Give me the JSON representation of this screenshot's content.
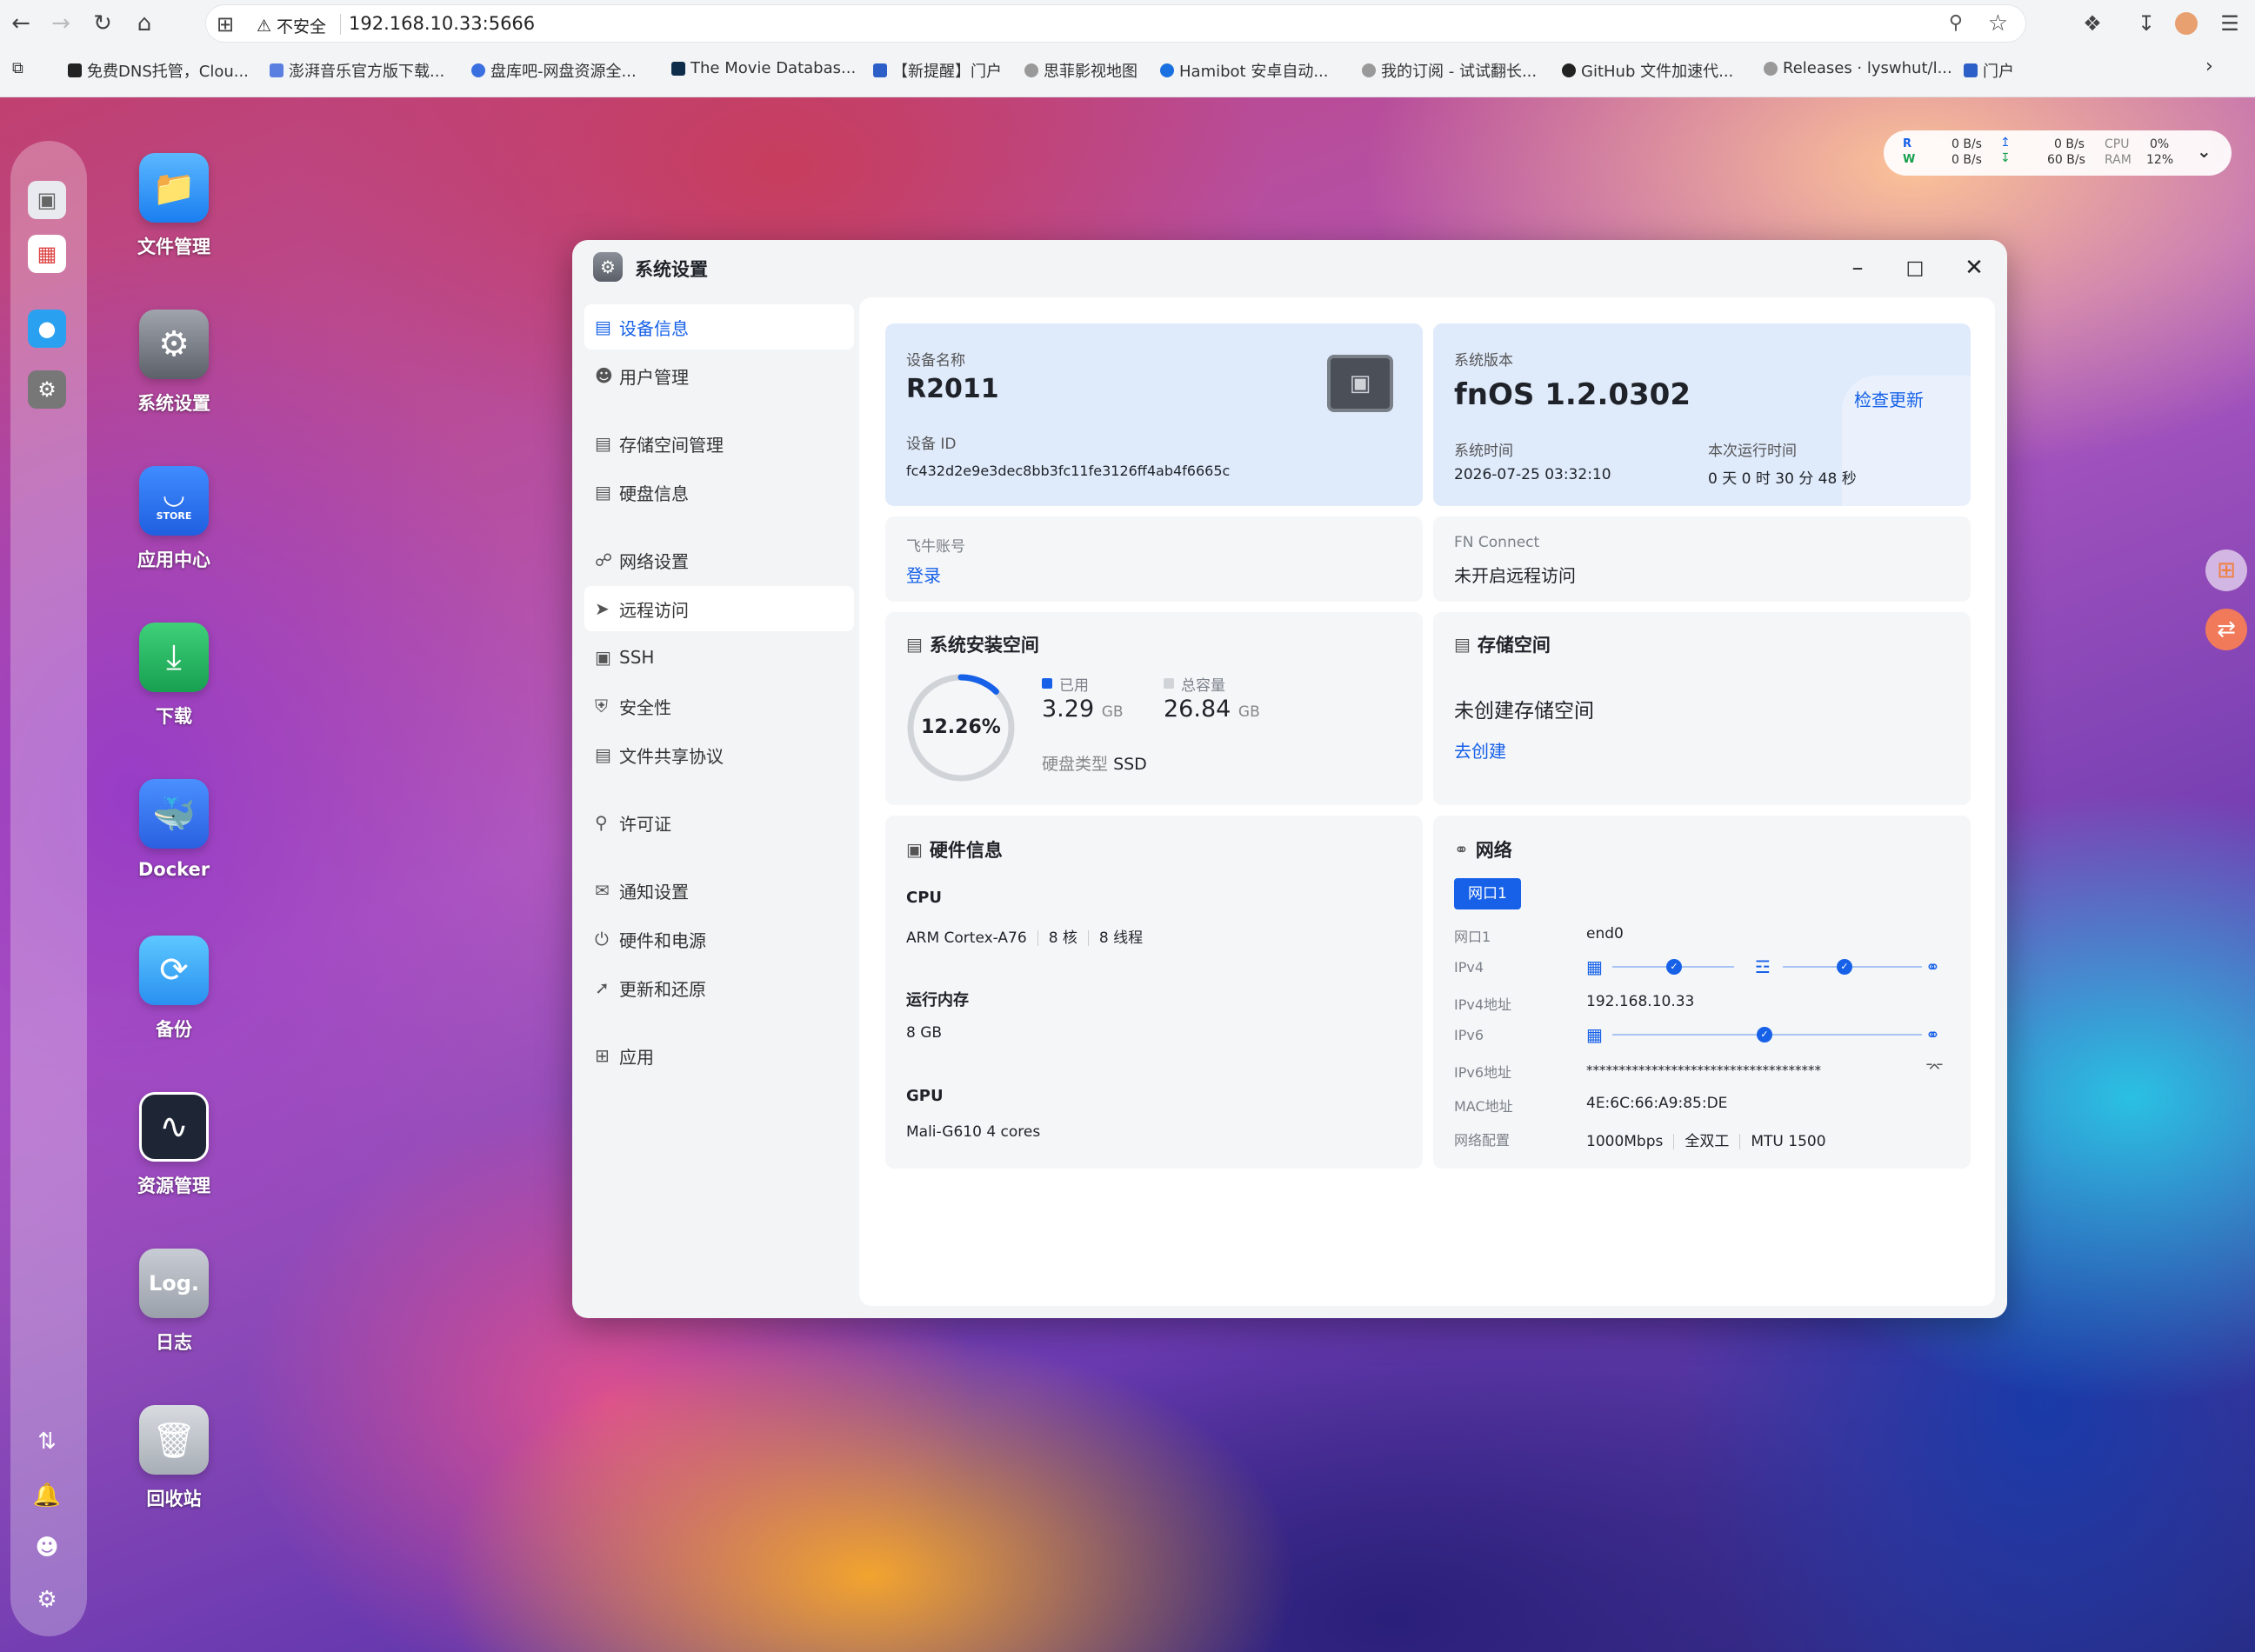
{
  "browser": {
    "address": {
      "security_warning": "不安全",
      "url": "192.168.10.33:5666"
    },
    "bookmarks": [
      "免费DNS托管，Clou...",
      "澎湃音乐官方版下载...",
      "盘库吧-网盘资源全...",
      "The Movie Databas...",
      "【新提醒】门户",
      "思菲影视地图",
      "Hamibot 安卓自动...",
      "我的订阅 - 试试翻长...",
      "GitHub 文件加速代...",
      "Releases · lyswhut/l...",
      "门户"
    ]
  },
  "desktop": {
    "apps": [
      "文件管理",
      "系统设置",
      "应用中心",
      "下载",
      "Docker",
      "备份",
      "资源管理",
      "日志",
      "回收站"
    ],
    "store_text": "STORE",
    "log_text": "Log."
  },
  "monitor": {
    "r_label": "R",
    "w_label": "W",
    "r_speed": "0  B/s",
    "w_speed": "0  B/s",
    "up_speed": "0  B/s",
    "down_speed": "60  B/s",
    "cpu_label": "CPU",
    "ram_label": "RAM",
    "cpu_value": "0%",
    "ram_value": "12%"
  },
  "window": {
    "title": "系统设置",
    "nav": [
      "设备信息",
      "用户管理",
      "存储空间管理",
      "硬盘信息",
      "网络设置",
      "远程访问",
      "SSH",
      "安全性",
      "文件共享协议",
      "许可证",
      "通知设置",
      "硬件和电源",
      "更新和还原",
      "应用"
    ],
    "active_nav_index": 0
  },
  "device": {
    "name_label": "设备名称",
    "name": "R2011",
    "id_label": "设备 ID",
    "id": "fc432d2e9e3dec8bb3fc11fe3126ff4ab4f6665c"
  },
  "system": {
    "version_label": "系统版本",
    "version": "fnOS  1.2.0302",
    "check_update": "检查更新",
    "time_label": "系统时间",
    "time": "2026-07-25 03:32:10",
    "uptime_label": "本次运行时间",
    "uptime": "0 天 0 时 30 分 48 秒"
  },
  "account": {
    "label": "飞牛账号",
    "login": "登录"
  },
  "fnconnect": {
    "label": "FN Connect",
    "status": "未开启远程访问"
  },
  "sys_space": {
    "title": "系统安装空间",
    "percent_text": "12.26%",
    "percent": 12.26,
    "used_label": "已用",
    "used": "3.29",
    "used_unit": "GB",
    "total_label": "总容量",
    "total": "26.84",
    "total_unit": "GB",
    "disk_type_label": "硬盘类型",
    "disk_type": "SSD",
    "colors": {
      "used": "#1661e8",
      "total": "#d0d3d8"
    }
  },
  "storage": {
    "title": "存储空间",
    "status": "未创建存储空间",
    "create": "去创建"
  },
  "hardware": {
    "title": "硬件信息",
    "cpu_label": "CPU",
    "cpu_model": "ARM Cortex-A76",
    "cpu_cores": "8 核",
    "cpu_threads": "8 线程",
    "ram_label": "运行内存",
    "ram": "8 GB",
    "gpu_label": "GPU",
    "gpu": "Mali-G610 4 cores"
  },
  "network": {
    "title": "网络",
    "tab": "网口1",
    "rows": {
      "port_label": "网口1",
      "port": "end0",
      "ipv4_label": "IPv4",
      "ipv4_addr_label": "IPv4地址",
      "ipv4_addr": "192.168.10.33",
      "ipv6_label": "IPv6",
      "ipv6_addr_label": "IPv6地址",
      "ipv6_addr": "************************************",
      "mac_label": "MAC地址",
      "mac": "4E:6C:66:A9:85:DE",
      "config_label": "网络配置",
      "speed": "1000Mbps",
      "duplex": "全双工",
      "mtu": "MTU 1500"
    },
    "accent": "#1661e8"
  }
}
